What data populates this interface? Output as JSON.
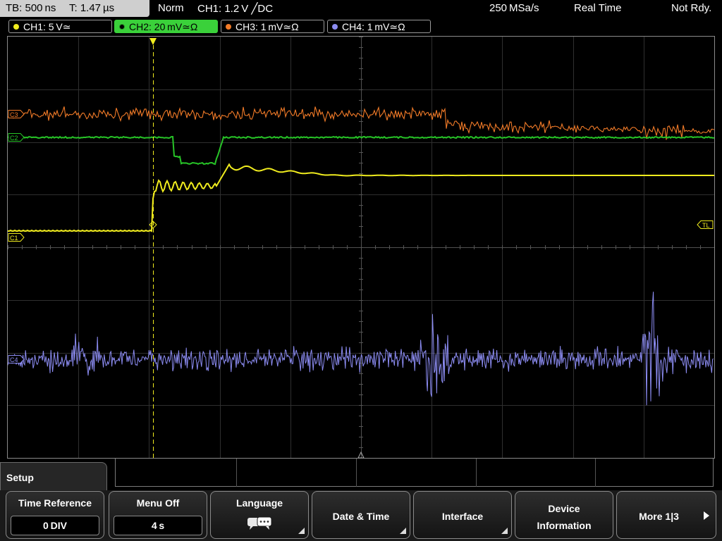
{
  "status": {
    "timebase": "TB: 500 ns",
    "trigger_time": "T: 1.47 µs",
    "mode": "Norm",
    "trigger_source": "CH1: 1.2 V ╱DC",
    "sample_rate": "250 MSa/s",
    "acq_mode": "Real Time",
    "state": "Not Rdy."
  },
  "channels": [
    {
      "label": "CH1: 5 V≃",
      "color": "#f0ec1e",
      "active": false
    },
    {
      "label": "CH2: 20 mV≃Ω",
      "color": "#27c427",
      "active": true
    },
    {
      "label": "CH3: 1 mV≃Ω",
      "color": "#f27b28",
      "active": false
    },
    {
      "label": "CH4: 1 mV≃Ω",
      "color": "#8c8cf2",
      "active": false
    }
  ],
  "screen": {
    "marker_c1": "C1",
    "marker_c2": "C2",
    "marker_c3": "C3",
    "marker_c4": "C4",
    "trigger_level": "TL"
  },
  "menu": {
    "title": "Setup",
    "softkeys": [
      {
        "title": "Time Reference",
        "value": "0 DIV"
      },
      {
        "title": "Menu Off",
        "value": "4 s"
      },
      {
        "title": "Language",
        "icon": "speech-bubbles-icon"
      },
      {
        "title": "Date & Time"
      },
      {
        "title": "Interface"
      },
      {
        "title": "Device",
        "title2": "Information"
      },
      {
        "title": "More 1|3"
      }
    ]
  }
}
